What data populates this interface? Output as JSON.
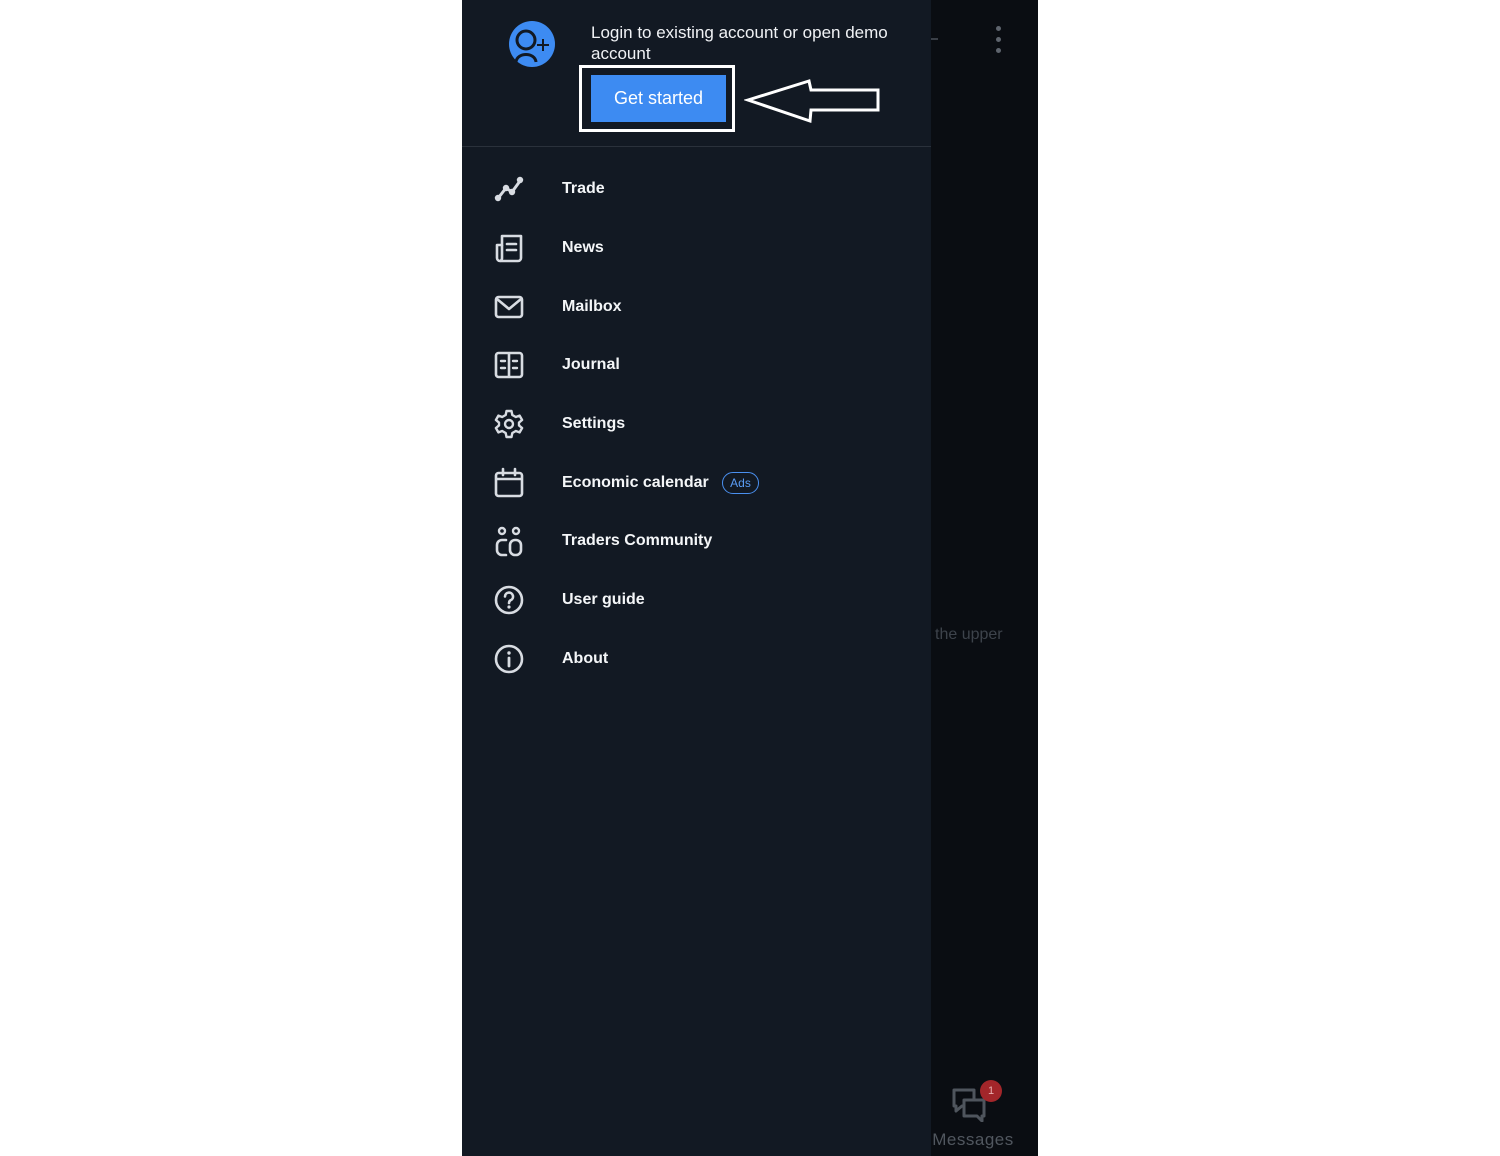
{
  "background": {
    "hint_text": "the upper",
    "messages_label": "Messages",
    "messages_badge": "1"
  },
  "header": {
    "login_text": "Login to existing account or open demo account",
    "get_started_label": "Get started"
  },
  "menu": {
    "items": [
      {
        "label": "Trade",
        "icon": "trade-chart-icon"
      },
      {
        "label": "News",
        "icon": "newspaper-icon"
      },
      {
        "label": "Mailbox",
        "icon": "envelope-icon"
      },
      {
        "label": "Journal",
        "icon": "journal-book-icon"
      },
      {
        "label": "Settings",
        "icon": "gear-icon"
      },
      {
        "label": "Economic calendar",
        "icon": "calendar-icon",
        "badge": "Ads"
      },
      {
        "label": "Traders Community",
        "icon": "community-icon"
      },
      {
        "label": "User guide",
        "icon": "help-circle-icon"
      },
      {
        "label": "About",
        "icon": "info-circle-icon"
      }
    ]
  },
  "colors": {
    "drawer_bg": "#121923",
    "accent": "#3d8bf2",
    "text": "#f4f6f8"
  }
}
